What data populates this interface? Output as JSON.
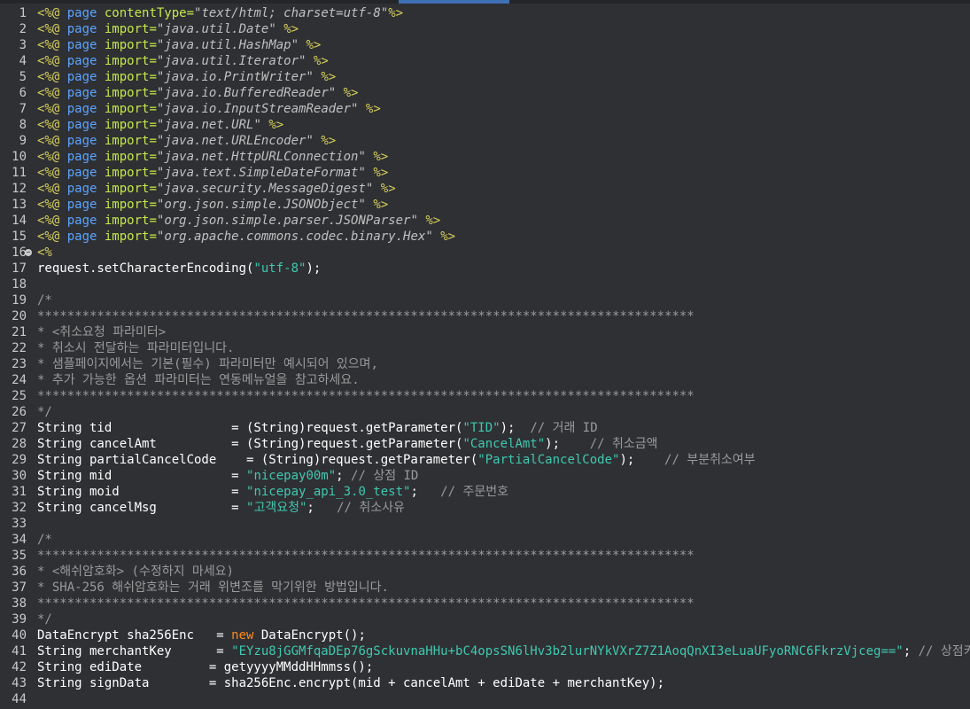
{
  "editor": {
    "colors": {
      "background": "#2f3034",
      "directive": "#d6cf5a",
      "keyword": "#5aa4ff",
      "attribute": "#c5e84a",
      "string": "#3fc8b0",
      "comment": "#9a9a9a",
      "new_keyword": "#ff8c1a"
    },
    "fold_line": 16,
    "lines": [
      {
        "n": "1",
        "tokens": [
          [
            "tag",
            "<%@ "
          ],
          [
            "kw",
            "page "
          ],
          [
            "attr",
            "contentType="
          ],
          [
            "stri",
            "\"text/html; charset=utf-8\""
          ],
          [
            "tag",
            "%>"
          ]
        ]
      },
      {
        "n": "2",
        "tokens": [
          [
            "tag",
            "<%@ "
          ],
          [
            "kw",
            "page "
          ],
          [
            "attr",
            "import="
          ],
          [
            "stri",
            "\"java.util.Date\" "
          ],
          [
            "tag",
            "%>"
          ]
        ]
      },
      {
        "n": "3",
        "tokens": [
          [
            "tag",
            "<%@ "
          ],
          [
            "kw",
            "page "
          ],
          [
            "attr",
            "import="
          ],
          [
            "stri",
            "\"java.util.HashMap\" "
          ],
          [
            "tag",
            "%>"
          ]
        ]
      },
      {
        "n": "4",
        "tokens": [
          [
            "tag",
            "<%@ "
          ],
          [
            "kw",
            "page "
          ],
          [
            "attr",
            "import="
          ],
          [
            "stri",
            "\"java.util.Iterator\" "
          ],
          [
            "tag",
            "%>"
          ]
        ]
      },
      {
        "n": "5",
        "tokens": [
          [
            "tag",
            "<%@ "
          ],
          [
            "kw",
            "page "
          ],
          [
            "attr",
            "import="
          ],
          [
            "stri",
            "\"java.io.PrintWriter\" "
          ],
          [
            "tag",
            "%>"
          ]
        ]
      },
      {
        "n": "6",
        "tokens": [
          [
            "tag",
            "<%@ "
          ],
          [
            "kw",
            "page "
          ],
          [
            "attr",
            "import="
          ],
          [
            "stri",
            "\"java.io.BufferedReader\" "
          ],
          [
            "tag",
            "%>"
          ]
        ]
      },
      {
        "n": "7",
        "tokens": [
          [
            "tag",
            "<%@ "
          ],
          [
            "kw",
            "page "
          ],
          [
            "attr",
            "import="
          ],
          [
            "stri",
            "\"java.io.InputStreamReader\" "
          ],
          [
            "tag",
            "%>"
          ]
        ]
      },
      {
        "n": "8",
        "tokens": [
          [
            "tag",
            "<%@ "
          ],
          [
            "kw",
            "page "
          ],
          [
            "attr",
            "import="
          ],
          [
            "stri",
            "\"java.net.URL\" "
          ],
          [
            "tag",
            "%>"
          ]
        ]
      },
      {
        "n": "9",
        "tokens": [
          [
            "tag",
            "<%@ "
          ],
          [
            "kw",
            "page "
          ],
          [
            "attr",
            "import="
          ],
          [
            "stri",
            "\"java.net.URLEncoder\" "
          ],
          [
            "tag",
            "%>"
          ]
        ]
      },
      {
        "n": "10",
        "tokens": [
          [
            "tag",
            "<%@ "
          ],
          [
            "kw",
            "page "
          ],
          [
            "attr",
            "import="
          ],
          [
            "stri",
            "\"java.net.HttpURLConnection\" "
          ],
          [
            "tag",
            "%>"
          ]
        ]
      },
      {
        "n": "11",
        "tokens": [
          [
            "tag",
            "<%@ "
          ],
          [
            "kw",
            "page "
          ],
          [
            "attr",
            "import="
          ],
          [
            "stri",
            "\"java.text.SimpleDateFormat\" "
          ],
          [
            "tag",
            "%>"
          ]
        ]
      },
      {
        "n": "12",
        "tokens": [
          [
            "tag",
            "<%@ "
          ],
          [
            "kw",
            "page "
          ],
          [
            "attr",
            "import="
          ],
          [
            "stri",
            "\"java.security.MessageDigest\" "
          ],
          [
            "tag",
            "%>"
          ]
        ]
      },
      {
        "n": "13",
        "tokens": [
          [
            "tag",
            "<%@ "
          ],
          [
            "kw",
            "page "
          ],
          [
            "attr",
            "import="
          ],
          [
            "stri",
            "\"org.json.simple.JSONObject\" "
          ],
          [
            "tag",
            "%>"
          ]
        ]
      },
      {
        "n": "14",
        "tokens": [
          [
            "tag",
            "<%@ "
          ],
          [
            "kw",
            "page "
          ],
          [
            "attr",
            "import="
          ],
          [
            "stri",
            "\"org.json.simple.parser.JSONParser\" "
          ],
          [
            "tag",
            "%>"
          ]
        ]
      },
      {
        "n": "15",
        "tokens": [
          [
            "tag",
            "<%@ "
          ],
          [
            "kw",
            "page "
          ],
          [
            "attr",
            "import="
          ],
          [
            "stri",
            "\"org.apache.commons.codec.binary.Hex\" "
          ],
          [
            "tag",
            "%>"
          ]
        ]
      },
      {
        "n": "16",
        "tokens": [
          [
            "tag",
            "<%"
          ]
        ]
      },
      {
        "n": "17",
        "tokens": [
          [
            "plain",
            "request.setCharacterEncoding("
          ],
          [
            "str",
            "\"utf-8\""
          ],
          [
            "plain",
            ");"
          ]
        ]
      },
      {
        "n": "18",
        "tokens": []
      },
      {
        "n": "19",
        "tokens": [
          [
            "com",
            "/*"
          ]
        ]
      },
      {
        "n": "20",
        "tokens": [
          [
            "com",
            "****************************************************************************************"
          ]
        ]
      },
      {
        "n": "21",
        "tokens": [
          [
            "com",
            "* <취소요청 파라미터>"
          ]
        ]
      },
      {
        "n": "22",
        "tokens": [
          [
            "com",
            "* 취소시 전달하는 파라미터입니다."
          ]
        ]
      },
      {
        "n": "23",
        "tokens": [
          [
            "com",
            "* 샘플페이지에서는 기본(필수) 파라미터만 예시되어 있으며,"
          ]
        ]
      },
      {
        "n": "24",
        "tokens": [
          [
            "com",
            "* 추가 가능한 옵션 파라미터는 연동메뉴얼을 참고하세요."
          ]
        ]
      },
      {
        "n": "25",
        "tokens": [
          [
            "com",
            "****************************************************************************************"
          ]
        ]
      },
      {
        "n": "26",
        "tokens": [
          [
            "com",
            "*/"
          ]
        ]
      },
      {
        "n": "27",
        "tokens": [
          [
            "plain",
            "String tid                = (String)request.getParameter("
          ],
          [
            "str",
            "\"TID\""
          ],
          [
            "plain",
            ");  "
          ],
          [
            "com",
            "// 거래 ID"
          ]
        ]
      },
      {
        "n": "28",
        "tokens": [
          [
            "plain",
            "String cancelAmt          = (String)request.getParameter("
          ],
          [
            "str",
            "\"CancelAmt\""
          ],
          [
            "plain",
            ");    "
          ],
          [
            "com",
            "// 취소금액"
          ]
        ]
      },
      {
        "n": "29",
        "tokens": [
          [
            "plain",
            "String partialCancelCode    = (String)request.getParameter("
          ],
          [
            "str",
            "\"PartialCancelCode\""
          ],
          [
            "plain",
            ");    "
          ],
          [
            "com",
            "// 부분취소여부"
          ]
        ]
      },
      {
        "n": "30",
        "tokens": [
          [
            "plain",
            "String mid                = "
          ],
          [
            "str",
            "\"nicepay00m\""
          ],
          [
            "plain",
            "; "
          ],
          [
            "com",
            "// 상점 ID"
          ]
        ]
      },
      {
        "n": "31",
        "tokens": [
          [
            "plain",
            "String moid               = "
          ],
          [
            "str",
            "\"nicepay_api_3.0_test\""
          ],
          [
            "plain",
            ";   "
          ],
          [
            "com",
            "// 주문번호"
          ]
        ]
      },
      {
        "n": "32",
        "tokens": [
          [
            "plain",
            "String cancelMsg          = "
          ],
          [
            "str",
            "\"고객요청\""
          ],
          [
            "plain",
            ";   "
          ],
          [
            "com",
            "// 취소사유"
          ]
        ]
      },
      {
        "n": "33",
        "tokens": []
      },
      {
        "n": "34",
        "tokens": [
          [
            "com",
            "/*"
          ]
        ]
      },
      {
        "n": "35",
        "tokens": [
          [
            "com",
            "****************************************************************************************"
          ]
        ]
      },
      {
        "n": "36",
        "tokens": [
          [
            "com",
            "* <해쉬암호화> (수정하지 마세요)"
          ]
        ]
      },
      {
        "n": "37",
        "tokens": [
          [
            "com",
            "* SHA-256 해쉬암호화는 거래 위변조를 막기위한 방법입니다."
          ]
        ]
      },
      {
        "n": "38",
        "tokens": [
          [
            "com",
            "****************************************************************************************"
          ]
        ]
      },
      {
        "n": "39",
        "tokens": [
          [
            "com",
            "*/"
          ]
        ]
      },
      {
        "n": "40",
        "tokens": [
          [
            "plain",
            "DataEncrypt sha256Enc   = "
          ],
          [
            "new",
            "new "
          ],
          [
            "plain",
            "DataEncrypt();"
          ]
        ]
      },
      {
        "n": "41",
        "tokens": [
          [
            "plain",
            "String merchantKey      = "
          ],
          [
            "str",
            "\"EYzu8jGGMfqaDEp76gSckuvnaHHu+bC4opsSN6lHv3b2lurNYkVXrZ7Z1AoqQnXI3eLuaUFyoRNC6FkrzVjceg==\""
          ],
          [
            "plain",
            "; "
          ],
          [
            "com",
            "// 상점키"
          ]
        ]
      },
      {
        "n": "42",
        "tokens": [
          [
            "plain",
            "String ediDate         = getyyyyMMddHHmmss();"
          ]
        ]
      },
      {
        "n": "43",
        "tokens": [
          [
            "plain",
            "String signData        = sha256Enc.encrypt(mid + cancelAmt + ediDate + merchantKey);"
          ]
        ]
      },
      {
        "n": "44",
        "tokens": []
      }
    ]
  }
}
